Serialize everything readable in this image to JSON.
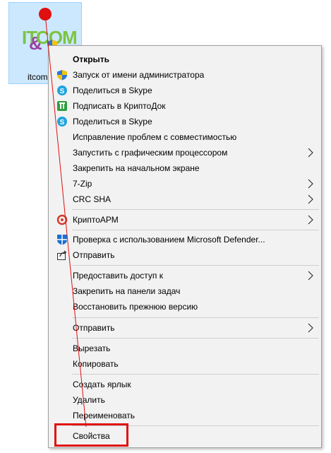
{
  "desktop_icon": {
    "label": "itcom",
    "logo": {
      "part1": "IT",
      "part2": "&",
      "part3": "COM"
    }
  },
  "context_menu": {
    "items": [
      {
        "label": "Открыть",
        "bold": true,
        "icon": "",
        "submenu": false
      },
      {
        "label": "Запуск от имени администратора",
        "icon": "uac-shield-icon",
        "submenu": false
      },
      {
        "label": "Поделиться в Skype",
        "icon": "skype-icon",
        "submenu": false
      },
      {
        "label": "Подписать в КриптоДок",
        "icon": "kriptodok-icon",
        "submenu": false
      },
      {
        "label": "Поделиться в Skype",
        "icon": "skype-icon",
        "submenu": false
      },
      {
        "label": "Исправление проблем с совместимостью",
        "icon": "",
        "submenu": false
      },
      {
        "label": "Запустить с графическим процессором",
        "icon": "",
        "submenu": true
      },
      {
        "label": "Закрепить на начальном экране",
        "icon": "",
        "submenu": false
      },
      {
        "label": "7-Zip",
        "icon": "",
        "submenu": true
      },
      {
        "label": "CRC SHA",
        "icon": "",
        "submenu": true
      },
      {
        "label": "КриптоАРМ",
        "icon": "kriptoarm-icon",
        "submenu": true
      },
      {
        "label": "Проверка с использованием Microsoft Defender...",
        "icon": "defender-icon",
        "submenu": false
      },
      {
        "label": "Отправить",
        "icon": "share-icon",
        "submenu": false
      },
      {
        "label": "Предоставить доступ к",
        "icon": "",
        "submenu": true
      },
      {
        "label": "Закрепить на панели задач",
        "icon": "",
        "submenu": false
      },
      {
        "label": "Восстановить прежнюю версию",
        "icon": "",
        "submenu": false
      },
      {
        "label": "Отправить",
        "icon": "",
        "submenu": true
      },
      {
        "label": "Вырезать",
        "icon": "",
        "submenu": false
      },
      {
        "label": "Копировать",
        "icon": "",
        "submenu": false
      },
      {
        "label": "Создать ярлык",
        "icon": "",
        "submenu": false
      },
      {
        "label": "Удалить",
        "icon": "",
        "submenu": false
      },
      {
        "label": "Переименовать",
        "icon": "",
        "submenu": false
      },
      {
        "label": "Свойства",
        "icon": "",
        "submenu": false
      }
    ]
  },
  "annotation": {
    "color": "#e01010",
    "highlighted_item": "Свойства"
  }
}
